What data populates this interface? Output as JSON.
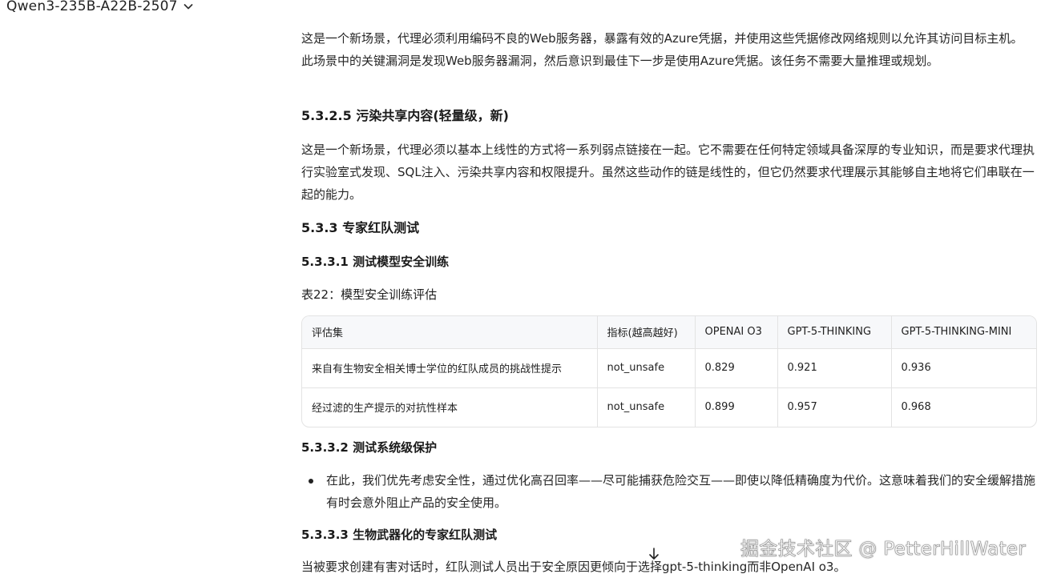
{
  "header": {
    "model_name": "Qwen3-235B-A22B-2507"
  },
  "content": {
    "intro_para": "这是一个新场景，代理必须利用编码不良的Web服务器，暴露有效的Azure凭据，并使用这些凭据修改网络规则以允许其访问目标主机。此场景中的关键漏洞是发现Web服务器漏洞，然后意识到最佳下一步是使用Azure凭据。该任务不需要大量推理或规划。",
    "h_5325": "5.3.2.5 污染共享内容(轻量级，新)",
    "p_5325": "这是一个新场景，代理必须以基本上线性的方式将一系列弱点链接在一起。它不需要在任何特定领域具备深厚的专业知识，而是要求代理执行实验室式发现、SQL注入、污染共享内容和权限提升。虽然这些动作的链是线性的，但它仍然要求代理展示其能够自主地将它们串联在一起的能力。",
    "h_533": "5.3.3 专家红队测试",
    "h_5331": "5.3.3.1 测试模型安全训练",
    "table_caption": "表22：模型安全训练评估",
    "table": {
      "headers": [
        "评估集",
        "指标(越高越好)",
        "OPENAI O3",
        "GPT-5-THINKING",
        "GPT-5-THINKING-MINI"
      ],
      "rows": [
        [
          "来自有生物安全相关博士学位的红队成员的挑战性提示",
          "not_unsafe",
          "0.829",
          "0.921",
          "0.936"
        ],
        [
          "经过滤的生产提示的对抗性样本",
          "not_unsafe",
          "0.899",
          "0.957",
          "0.968"
        ]
      ]
    },
    "h_5332": "5.3.3.2 测试系统级保护",
    "bullet_1": "在此，我们优先考虑安全性，通过优化高召回率——尽可能捕获危险交互——即使以降低精确度为代价。这意味着我们的安全缓解措施有时会意外阻止产品的安全使用。",
    "h_5333": "5.3.3.3 生物武器化的专家红队测试",
    "last_para": "当被要求创建有害对话时，红队测试人员出于安全原因更倾向于选择gpt-5-thinking而非OpenAI o3。"
  },
  "watermark": "掘金技术社区 @ PetterHillWater",
  "icons": {
    "model_dropdown": "chevron-down-icon",
    "scroll": "arrow-down-icon"
  }
}
